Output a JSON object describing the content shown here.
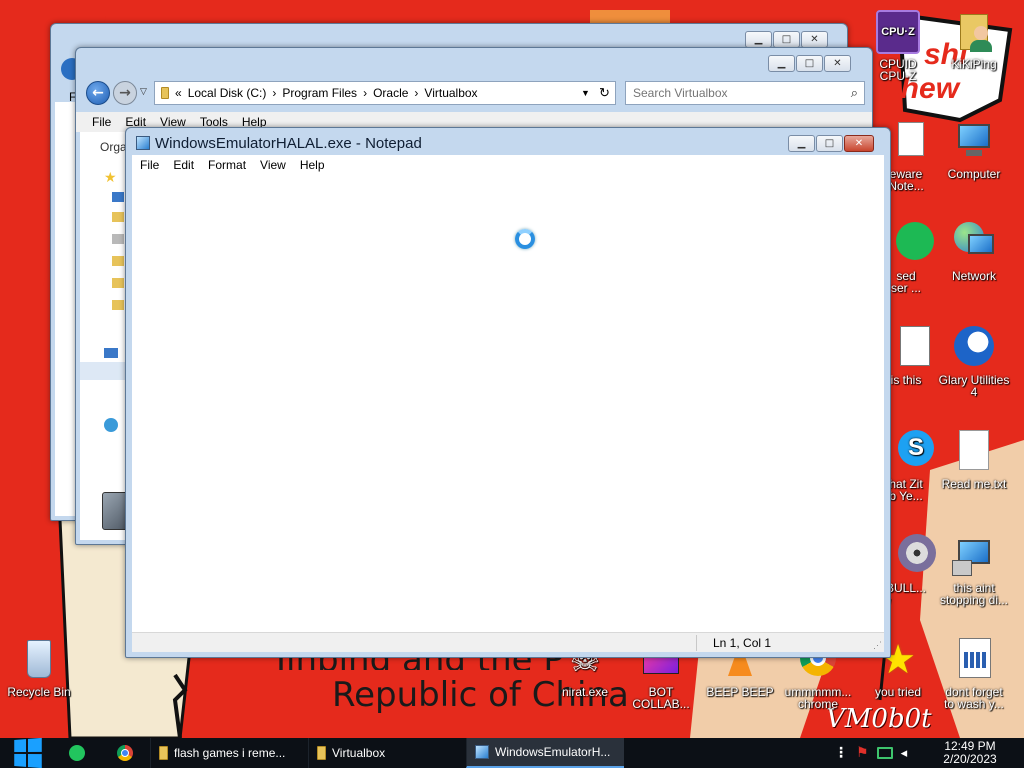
{
  "wallpaper": {
    "corner_text_top": "shi",
    "corner_text_bottom": "chew",
    "banner_line1": "Jinping and the P",
    "banner_line2": "Republic of China",
    "watermark": "VM0b0t"
  },
  "desktop_icons_right": [
    {
      "label_line1": "CPUID",
      "label_line2": "CPU-Z",
      "icon": "cpuz-icon"
    },
    {
      "label_line1": "KiKiPing",
      "label_line2": "",
      "icon": "folder-user-icon"
    },
    {
      "label_line1": "eware",
      "label_line2": "Note...",
      "icon": "notepad-icon"
    },
    {
      "label_line1": "Computer",
      "label_line2": "",
      "icon": "computer-icon"
    },
    {
      "label_line1": "sed",
      "label_line2": "ser ...",
      "icon": "spotify-icon"
    },
    {
      "label_line1": "Network",
      "label_line2": "",
      "icon": "network-icon"
    },
    {
      "label_line1": "is this",
      "label_line2": "",
      "icon": "document-icon"
    },
    {
      "label_line1": "Glary Utilities",
      "label_line2": "4",
      "icon": "glary-icon"
    },
    {
      "label_line1": "hat Zit",
      "label_line2": "b Ye...",
      "icon": "skype-icon"
    },
    {
      "label_line1": "Read me.txt",
      "label_line2": "",
      "icon": "text-file-icon"
    },
    {
      "label_line1": "BULL...",
      "label_line2": "",
      "icon": "disc-icon"
    },
    {
      "label_line1": "this aint",
      "label_line2": "stopping di...",
      "icon": "installer-icon"
    },
    {
      "label_line1": "you tried",
      "label_line2": "",
      "icon": "star-icon"
    },
    {
      "label_line1": "dont forget",
      "label_line2": "to wash y...",
      "icon": "calendar-doc-icon"
    }
  ],
  "desktop_icons_bottom": [
    {
      "label_line1": "Recycle Bin",
      "label_line2": "",
      "icon": "recycle-bin-icon"
    },
    {
      "label_line1": "nirat.exe",
      "label_line2": "",
      "icon": "skull-icon"
    },
    {
      "label_line1": "BOT",
      "label_line2": "COLLAB...",
      "icon": "video-icon"
    },
    {
      "label_line1": "BEEP BEEP",
      "label_line2": "",
      "icon": "vlc-icon"
    },
    {
      "label_line1": "ummmmm...",
      "label_line2": "chrome",
      "icon": "chrome-icon"
    }
  ],
  "explorer": {
    "breadcrumb_prefix": "«",
    "breadcrumb": [
      "Local Disk (C:)",
      "Program Files",
      "Oracle",
      "Virtualbox"
    ],
    "search_placeholder": "Search Virtualbox",
    "menu": [
      "File",
      "Edit",
      "View",
      "Tools",
      "Help"
    ],
    "organize": "Orga",
    "back_menu_letter": "F"
  },
  "notepad": {
    "title": "WindowsEmulatorHALAL.exe - Notepad",
    "menu": [
      "File",
      "Edit",
      "Format",
      "View",
      "Help"
    ],
    "status": "Ln 1, Col 1",
    "content": ""
  },
  "taskbar": {
    "tasks": [
      {
        "label": "flash games i reme...",
        "icon": "folder-icon"
      },
      {
        "label": "Virtualbox",
        "icon": "folder-icon"
      },
      {
        "label": "WindowsEmulatorH...",
        "icon": "notepad-icon"
      }
    ],
    "time": "12:49 PM",
    "date": "2/20/2023"
  },
  "colors": {
    "wallpaper_red": "#e52a1c",
    "wallpaper_cream": "#f4e9d0",
    "taskbar": "#0c1016",
    "window_frame": "#c4d8ee",
    "loading_ring": "#2a8fe0"
  }
}
